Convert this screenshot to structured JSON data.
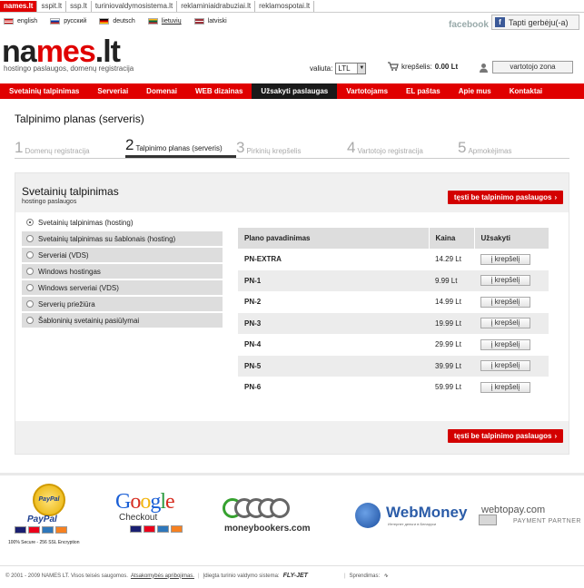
{
  "topbar": {
    "sites": [
      {
        "label": "names.lt"
      },
      {
        "label": "sspit.lt"
      },
      {
        "label": "ssp.lt"
      },
      {
        "label": "turiniovaldymosistema.lt"
      },
      {
        "label": "reklaminiaidrabuziai.lt"
      },
      {
        "label": "reklamospotai.lt"
      }
    ]
  },
  "languages": [
    "english",
    "русский",
    "deutsch",
    "lietuvių",
    "latviski"
  ],
  "facebook": {
    "label": "facebook",
    "like_label": "Tapti gerbėju(-a)"
  },
  "logo": {
    "part1": "na",
    "part2": "mes",
    "part3": ".lt",
    "tagline": "hostingo paslaugos, domenų registracija"
  },
  "currency": {
    "label": "valiuta:",
    "value": "LTL"
  },
  "cart": {
    "label": "krepšelis:",
    "amount": "0.00 Lt"
  },
  "user": {
    "label": "vartotojo zona"
  },
  "nav": [
    "Svetainių talpinimas",
    "Serveriai",
    "Domenai",
    "WEB dizainas",
    "Užsakyti paslaugas",
    "Vartotojams",
    "EL paštas",
    "Apie mus",
    "Kontaktai"
  ],
  "page": {
    "title": "Talpinimo planas (serveris)"
  },
  "steps": [
    {
      "num": "1",
      "label": "Domenų registracija"
    },
    {
      "num": "2",
      "label": "Talpinimo planas (serveris)"
    },
    {
      "num": "3",
      "label": "Pirkinių krepšelis"
    },
    {
      "num": "4",
      "label": "Vartotojo registracija"
    },
    {
      "num": "5",
      "label": "Apmokėjimas"
    }
  ],
  "panel": {
    "title": "Svetainių talpinimas",
    "subtitle": "hostingo paslaugos",
    "continue_label": "tęsti be talpinimo paslaugos"
  },
  "options": [
    "Svetainių talpinimas (hosting)",
    "Svetainių talpinimas su šablonais (hosting)",
    "Serveriai (VDS)",
    "Windows hostingas",
    "Windows serveriai (VDS)",
    "Serverių priežiūra",
    "Šabloninių svetainių pasiūlymai"
  ],
  "plans": {
    "headers": {
      "name": "Plano pavadinimas",
      "price": "Kaina",
      "order": "Užsakyti"
    },
    "button_label": "į krepšelį",
    "rows": [
      {
        "name": "PN-EXTRA",
        "price": "14.29 Lt"
      },
      {
        "name": "PN-1",
        "price": "9.99 Lt"
      },
      {
        "name": "PN-2",
        "price": "14.99 Lt"
      },
      {
        "name": "PN-3",
        "price": "19.99 Lt"
      },
      {
        "name": "PN-4",
        "price": "29.99 Lt"
      },
      {
        "name": "PN-5",
        "price": "39.99 Lt"
      },
      {
        "name": "PN-6",
        "price": "59.99 Lt"
      }
    ]
  },
  "payments": {
    "paypal_seal": "PayPal",
    "paypal_name": "PayPal",
    "paypal_secure": "100% Secure - 256 SSL Encryption",
    "google": [
      "G",
      "o",
      "o",
      "g",
      "l",
      "e"
    ],
    "google_checkout": "Checkout",
    "moneybookers": "moneybookers.com",
    "webmoney": "WebMoney",
    "webmoney_sub": "Интернет деньги в Беларуси",
    "webtopay": "webtopay.com",
    "webtopay_sub": "PAYMENT PARTNER"
  },
  "footer": {
    "copyright": "© 2001 - 2009 NAMES LT. Visos teisės saugomos.",
    "liability_link": "Atsakomybės apribojimas.",
    "cms_label": "Įdiegta turinio valdymo sistema:",
    "cms_brand": "FLY-JET",
    "solutions_label": "Sprendimas:"
  }
}
